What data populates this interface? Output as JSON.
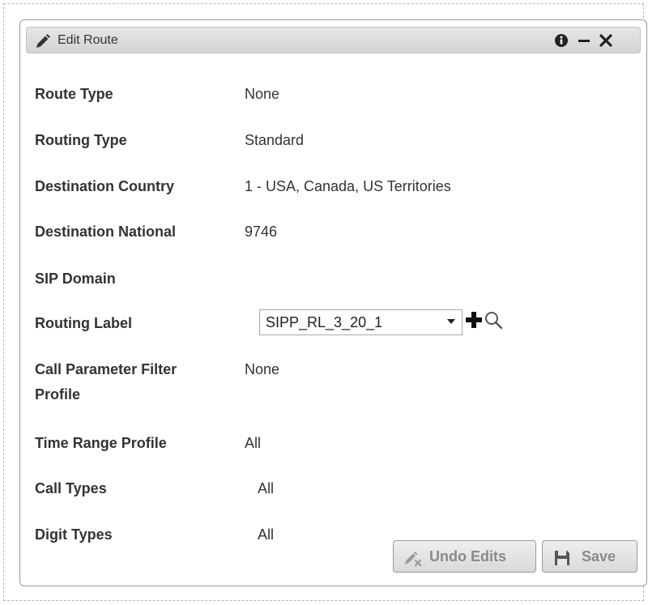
{
  "panel": {
    "title": "Edit Route",
    "icons": [
      "pencil-icon",
      "info-icon",
      "minimize-icon",
      "close-icon"
    ]
  },
  "fields": {
    "route_type": {
      "label": "Route Type",
      "value": "None"
    },
    "routing_type": {
      "label": "Routing Type",
      "value": "Standard"
    },
    "destination_country": {
      "label": "Destination Country",
      "value": "1 - USA, Canada, US Territories"
    },
    "destination_national": {
      "label": "Destination National",
      "value": "9746"
    },
    "sip_domain": {
      "label": "SIP Domain",
      "value": ""
    },
    "routing_label": {
      "label": "Routing Label",
      "selected": "SIPP_RL_3_20_1"
    },
    "call_parameter_filter_profile": {
      "label_line1": "Call Parameter Filter",
      "label_line2": "Profile",
      "value": "None"
    },
    "time_range_profile": {
      "label": "Time Range Profile",
      "value": "All"
    },
    "call_types": {
      "label": "Call Types",
      "value": "All"
    },
    "digit_types": {
      "label": "Digit Types",
      "value": "All"
    }
  },
  "buttons": {
    "undo_label": "Undo Edits",
    "save_label": "Save"
  }
}
